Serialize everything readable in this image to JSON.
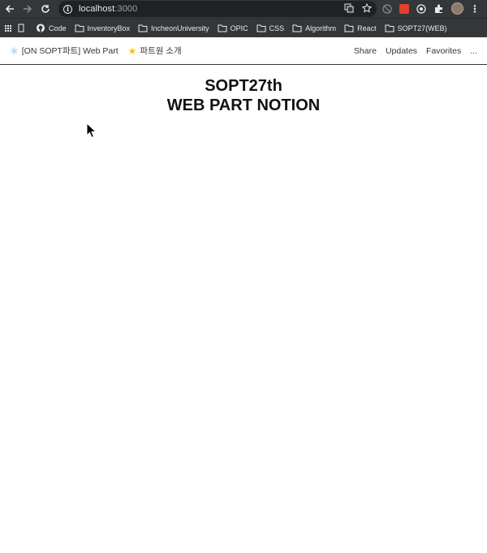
{
  "browser": {
    "url_host": "localhost",
    "url_port": ":3000",
    "bookmarks": [
      {
        "label": "Code",
        "icon": "github-icon"
      },
      {
        "label": "InventoryBox",
        "icon": "folder-icon"
      },
      {
        "label": "IncheonUniversity",
        "icon": "folder-icon"
      },
      {
        "label": "OPIC",
        "icon": "folder-icon"
      },
      {
        "label": "CSS",
        "icon": "folder-icon"
      },
      {
        "label": "Algorithm",
        "icon": "folder-icon"
      },
      {
        "label": "React",
        "icon": "folder-icon"
      },
      {
        "label": "SOPT27(WEB)",
        "icon": "folder-icon"
      }
    ]
  },
  "header": {
    "breadcrumbs": [
      {
        "icon": "atom-icon",
        "glyph": "⚛",
        "label": "[ON SOPT파트] Web Part"
      },
      {
        "icon": "star-icon",
        "glyph": "★",
        "label": "파트원 소개"
      }
    ],
    "actions": {
      "share": "Share",
      "updates": "Updates",
      "favorites": "Favorites",
      "more": "..."
    }
  },
  "main": {
    "title_line1": "SOPT27th",
    "title_line2": "WEB PART NOTION"
  },
  "colors": {
    "chrome_bg": "#35363a",
    "omnibox_bg": "#202124",
    "text_dark": "#37352f",
    "atom_blue": "#61b4e0",
    "star_yellow": "#f4c21b"
  }
}
